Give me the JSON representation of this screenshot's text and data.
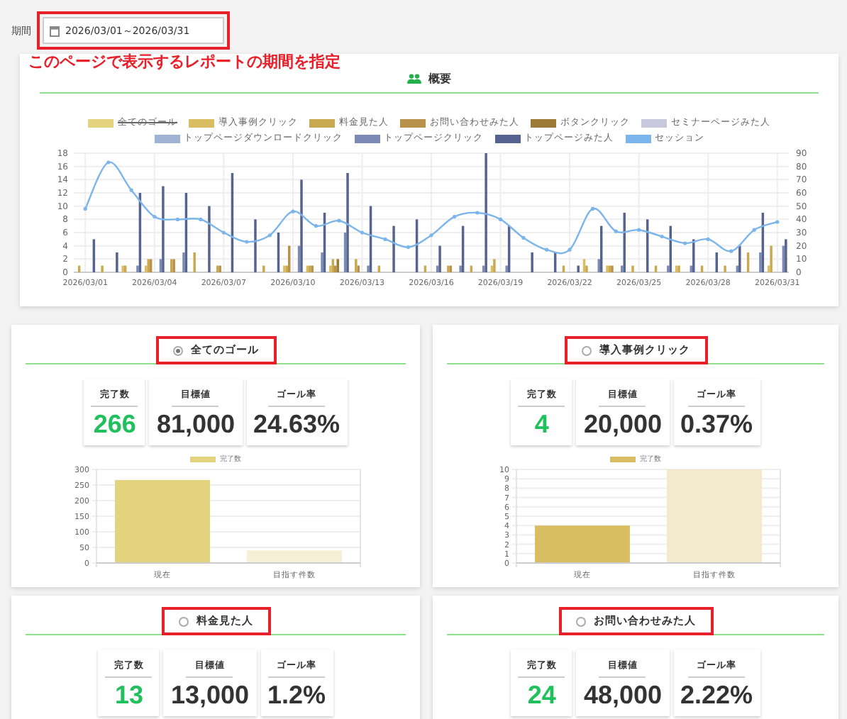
{
  "period": {
    "label": "期間",
    "value": "2026/03/01～2026/03/31"
  },
  "annotation": "このページで表示するレポートの期間を指定",
  "overview": {
    "title": "概要",
    "legend_states": [
      {
        "hidden": true
      },
      {
        "hidden": false
      },
      {
        "hidden": false
      },
      {
        "hidden": false
      },
      {
        "hidden": false
      },
      {
        "hidden": false
      },
      {
        "hidden": false
      },
      {
        "hidden": false
      },
      {
        "hidden": false
      },
      {
        "hidden": false
      }
    ],
    "chart_data": {
      "type": "bar",
      "grid": true,
      "x": [
        "2026/03/01",
        null,
        null,
        "2026/03/04",
        null,
        null,
        "2026/03/07",
        null,
        null,
        "2026/03/10",
        null,
        null,
        "2026/03/13",
        null,
        null,
        "2026/03/16",
        null,
        null,
        "2026/03/19",
        null,
        null,
        "2026/03/22",
        null,
        null,
        "2026/03/25",
        null,
        null,
        "2026/03/28",
        null,
        null,
        "2026/03/31"
      ],
      "ylim": [
        0,
        18
      ],
      "yticks": [
        0,
        2,
        4,
        6,
        8,
        10,
        12,
        14,
        16,
        18
      ],
      "y2lim": [
        0,
        90
      ],
      "y2ticks": [
        0,
        10,
        20,
        30,
        40,
        50,
        60,
        70,
        80,
        90
      ],
      "series": [
        {
          "name": "全てのゴール",
          "color": "#e3d27e",
          "values": [
            null,
            null,
            null,
            null,
            null,
            null,
            null,
            null,
            null,
            null,
            null,
            null,
            null,
            null,
            null,
            null,
            null,
            null,
            null,
            null,
            null,
            null,
            null,
            null,
            null,
            null,
            null,
            null,
            null,
            null,
            null
          ]
        },
        {
          "name": "導入事例クリック",
          "color": "#d8bd62",
          "values": [
            0,
            0,
            1,
            1,
            0,
            0,
            0,
            0,
            0,
            1,
            1,
            1,
            0,
            0,
            0,
            0,
            0,
            0,
            1,
            0,
            0,
            0,
            2,
            1,
            0,
            0,
            1,
            0,
            0,
            0,
            1
          ]
        },
        {
          "name": "料金見た人",
          "color": "#c9a94f",
          "values": [
            1,
            1,
            1,
            2,
            2,
            3,
            1,
            0,
            1,
            1,
            1,
            2,
            2,
            1,
            0,
            1,
            1,
            1,
            2,
            0,
            0,
            1,
            1,
            1,
            1,
            1,
            1,
            1,
            1,
            3,
            4
          ]
        },
        {
          "name": "お問い合わせみた人",
          "color": "#b8914a",
          "values": [
            0,
            0,
            0,
            2,
            2,
            0,
            1,
            0,
            0,
            4,
            1,
            1,
            1,
            0,
            0,
            0,
            1,
            0,
            0,
            0,
            0,
            0,
            0,
            1,
            0,
            0,
            0,
            0,
            0,
            0,
            0
          ]
        },
        {
          "name": "ボタンクリック",
          "color": "#9a7a34",
          "values": [
            0,
            0,
            0,
            0,
            0,
            0,
            0,
            0,
            0,
            0,
            0,
            2,
            0,
            0,
            0,
            0,
            0,
            0,
            0,
            0,
            0,
            0,
            0,
            0,
            0,
            0,
            0,
            0,
            0,
            0,
            0
          ]
        },
        {
          "name": "セミナーページみた人",
          "color": "#c8c8dc",
          "values": [
            0,
            0,
            0,
            0,
            0,
            0,
            0,
            0,
            0,
            0,
            0,
            0,
            0,
            0,
            0,
            0,
            0,
            0,
            0,
            0,
            0,
            0,
            0,
            0,
            0,
            0,
            0,
            0,
            0,
            0,
            0
          ]
        },
        {
          "name": "トップページダウンロードクリック",
          "color": "#9fb3d3",
          "values": [
            0,
            0,
            0,
            0,
            0,
            0,
            0,
            0,
            0,
            0,
            0,
            0,
            0,
            0,
            0,
            0,
            0,
            0,
            0,
            0,
            0,
            0,
            0,
            0,
            0,
            0,
            0,
            0,
            0,
            0,
            0
          ]
        },
        {
          "name": "トップページクリック",
          "color": "#7a8ab5",
          "values": [
            0,
            0,
            1,
            2,
            3,
            0,
            0,
            0,
            0,
            4,
            3,
            6,
            1,
            0,
            0,
            1,
            1,
            1,
            1,
            0,
            0,
            0,
            2,
            1,
            0,
            1,
            1,
            0,
            1,
            3,
            4
          ]
        },
        {
          "name": "トップページみた人",
          "color": "#55648e",
          "values": [
            5,
            3,
            12,
            13,
            12,
            10,
            15,
            8,
            6,
            14,
            9,
            15,
            10,
            7,
            8,
            4,
            7,
            18,
            7,
            3,
            3,
            1,
            7,
            9,
            8,
            7,
            5,
            3,
            4,
            9,
            5
          ]
        },
        {
          "name": "セッション",
          "color": "#7cb5ec",
          "type": "line",
          "axis": "y2",
          "values": [
            48,
            83,
            62,
            42,
            40,
            40,
            30,
            23,
            28,
            46,
            35,
            39,
            30,
            25,
            19,
            28,
            42,
            45,
            40,
            26,
            17,
            17,
            48,
            31,
            32,
            27,
            22,
            25,
            16,
            32,
            38
          ]
        }
      ]
    }
  },
  "goals": [
    {
      "name": "全てのゴール",
      "selected": true,
      "stats": [
        {
          "label": "完了数",
          "value": "266"
        },
        {
          "label": "目標値",
          "value": "81,000"
        },
        {
          "label": "ゴール率",
          "value": "24.63%"
        }
      ],
      "chart_data": {
        "type": "bar",
        "grid": true,
        "categories": [
          "現在",
          "目指す件数"
        ],
        "ylim": [
          0,
          300
        ],
        "yticks": [
          0,
          50,
          100,
          150,
          200,
          250,
          300
        ],
        "series": [
          {
            "name": "完了数",
            "color": "#e3d27e",
            "colors": [
              "#e3d27e",
              "#f5efd6"
            ],
            "values": [
              266,
              40
            ]
          }
        ]
      }
    },
    {
      "name": "導入事例クリック",
      "selected": false,
      "stats": [
        {
          "label": "完了数",
          "value": "4"
        },
        {
          "label": "目標値",
          "value": "20,000"
        },
        {
          "label": "ゴール率",
          "value": "0.37%"
        }
      ],
      "chart_data": {
        "type": "bar",
        "grid": true,
        "categories": [
          "現在",
          "目指す件数"
        ],
        "ylim": [
          0,
          10
        ],
        "yticks": [
          0,
          1,
          2,
          3,
          4,
          5,
          6,
          7,
          8,
          9,
          10
        ],
        "series": [
          {
            "name": "完了数",
            "color": "#d8bd62",
            "colors": [
              "#d8bd62",
              "#f3e9cc"
            ],
            "values": [
              4,
              10
            ]
          }
        ]
      }
    },
    {
      "name": "料金見た人",
      "selected": false,
      "stats": [
        {
          "label": "完了数",
          "value": "13"
        },
        {
          "label": "目標値",
          "value": "13,000"
        },
        {
          "label": "ゴール率",
          "value": "1.2%"
        }
      ]
    },
    {
      "name": "お問い合わせみた人",
      "selected": false,
      "stats": [
        {
          "label": "完了数",
          "value": "24"
        },
        {
          "label": "目標値",
          "value": "48,000"
        },
        {
          "label": "ゴール率",
          "value": "2.22%"
        }
      ]
    }
  ]
}
